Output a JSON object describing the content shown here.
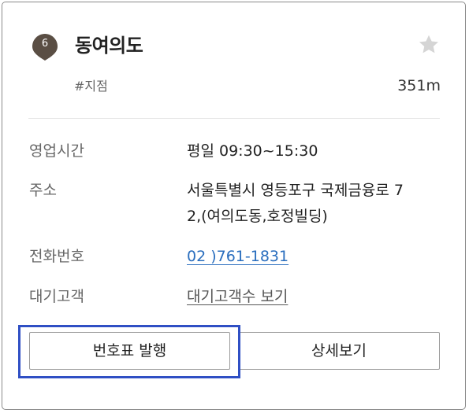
{
  "branch": {
    "number": "6",
    "name": "동여의도",
    "tag": "#지점",
    "distance": "351m",
    "favorite_icon": "star-icon",
    "pin_color": "#5a4e44"
  },
  "info": {
    "hours": {
      "label": "영업시간",
      "value": "평일 09:30~15:30"
    },
    "address": {
      "label": "주소",
      "line1": "서울특별시 영등포구 국제금융로 7",
      "line2": "2,(여의도동,호정빌딩)"
    },
    "phone": {
      "label": "전화번호",
      "value": "02 )761-1831"
    },
    "waiting": {
      "label": "대기고객",
      "value": "대기고객수 보기"
    }
  },
  "buttons": {
    "ticket": "번호표 발행",
    "details": "상세보기"
  },
  "colors": {
    "link": "#2a6ebe",
    "highlight": "#2f4fc4"
  }
}
